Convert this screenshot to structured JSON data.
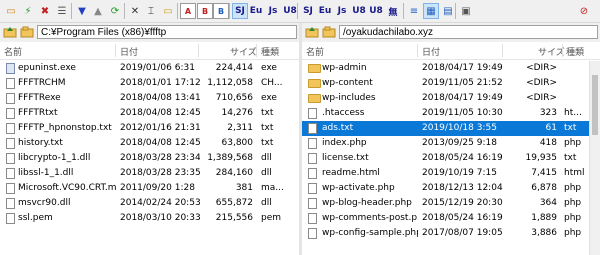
{
  "toolbar": {
    "buttons": [
      {
        "icon": "folder-open-icon"
      },
      {
        "icon": "connect-icon"
      },
      {
        "icon": "disconnect-icon"
      },
      {
        "icon": "menu-icon"
      },
      {
        "icon": "download-icon"
      },
      {
        "icon": "upload-icon"
      },
      {
        "icon": "refresh-icon"
      },
      {
        "icon": "delete-icon"
      },
      {
        "icon": "rename-icon"
      },
      {
        "icon": "new-folder-icon"
      },
      {
        "icon": "mode-a-icon",
        "text": "A"
      },
      {
        "icon": "mode-b-icon",
        "text": "B"
      },
      {
        "icon": "mode-auto-icon",
        "text": "B"
      },
      {
        "icon": "sjis-icon",
        "text": "SJ"
      },
      {
        "icon": "euc-icon",
        "text": "Eu"
      },
      {
        "icon": "jis-icon",
        "text": "Js"
      },
      {
        "icon": "utf8-icon",
        "text": "U8"
      },
      {
        "icon": "sjis2-icon",
        "text": "SJ"
      },
      {
        "icon": "euc2-icon",
        "text": "Eu"
      },
      {
        "icon": "jis2-icon",
        "text": "Js"
      },
      {
        "icon": "utf8n-icon",
        "text": "U8"
      },
      {
        "icon": "utf8bom-icon",
        "text": "U8"
      },
      {
        "icon": "no-convert-icon",
        "text": "無"
      },
      {
        "icon": "list-view-icon"
      },
      {
        "icon": "detail-view-icon"
      },
      {
        "icon": "grid-view-icon"
      },
      {
        "icon": "settings-icon"
      },
      {
        "icon": "stop-icon"
      }
    ]
  },
  "left": {
    "path": "C:¥Program Files (x86)¥ffftp",
    "headers": {
      "name": "名前",
      "date": "日付",
      "size": "サイズ",
      "type": "種類"
    },
    "files": [
      {
        "name": "epuninst.exe",
        "date": "2019/01/06  6:31",
        "size": "224,414",
        "type": "exe",
        "kind": "exe"
      },
      {
        "name": "FFFTRCHM",
        "date": "2018/01/01 17:12",
        "size": "1,112,058",
        "type": "CH...",
        "kind": "doc"
      },
      {
        "name": "FFFTRexe",
        "date": "2018/04/08 13:41",
        "size": "710,656",
        "type": "exe",
        "kind": "doc"
      },
      {
        "name": "FFFTRtxt",
        "date": "2018/04/08 12:45",
        "size": "14,276",
        "type": "txt",
        "kind": "doc"
      },
      {
        "name": "FFFTP_hpnonstop.txt",
        "date": "2012/01/16 21:31",
        "size": "2,311",
        "type": "txt",
        "kind": "doc"
      },
      {
        "name": "history.txt",
        "date": "2018/04/08 12:45",
        "size": "63,800",
        "type": "txt",
        "kind": "doc"
      },
      {
        "name": "libcrypto-1_1.dll",
        "date": "2018/03/28 23:34",
        "size": "1,389,568",
        "type": "dll",
        "kind": "doc"
      },
      {
        "name": "libssl-1_1.dll",
        "date": "2018/03/28 23:35",
        "size": "284,160",
        "type": "dll",
        "kind": "doc"
      },
      {
        "name": "Microsoft.VC90.CRT.m...",
        "date": "2011/09/20  1:28",
        "size": "381",
        "type": "ma...",
        "kind": "doc"
      },
      {
        "name": "msvcr90.dll",
        "date": "2014/02/24 20:53",
        "size": "655,872",
        "type": "dll",
        "kind": "doc"
      },
      {
        "name": "ssl.pem",
        "date": "2018/03/10 20:33",
        "size": "215,556",
        "type": "pem",
        "kind": "doc"
      }
    ]
  },
  "right": {
    "path": "/oyakudachilabo.xyz",
    "headers": {
      "name": "名前",
      "date": "日付",
      "size": "サイズ",
      "type": "種類"
    },
    "files": [
      {
        "name": "wp-admin",
        "date": "2018/04/17 19:49",
        "size": "<DIR>",
        "type": "",
        "kind": "folder"
      },
      {
        "name": "wp-content",
        "date": "2019/11/05 21:52",
        "size": "<DIR>",
        "type": "",
        "kind": "folder"
      },
      {
        "name": "wp-includes",
        "date": "2018/04/17 19:49",
        "size": "<DIR>",
        "type": "",
        "kind": "folder"
      },
      {
        "name": ".htaccess",
        "date": "2019/11/05 10:30",
        "size": "323",
        "type": "ht...",
        "kind": "doc"
      },
      {
        "name": "ads.txt",
        "date": "2019/10/18  3:55",
        "size": "61",
        "type": "txt",
        "kind": "doc",
        "selected": true
      },
      {
        "name": "index.php",
        "date": "2013/09/25  9:18",
        "size": "418",
        "type": "php",
        "kind": "doc"
      },
      {
        "name": "license.txt",
        "date": "2018/05/24 16:19",
        "size": "19,935",
        "type": "txt",
        "kind": "doc"
      },
      {
        "name": "readme.html",
        "date": "2019/10/19  7:15",
        "size": "7,415",
        "type": "html",
        "kind": "doc"
      },
      {
        "name": "wp-activate.php",
        "date": "2018/12/13 12:04",
        "size": "6,878",
        "type": "php",
        "kind": "doc"
      },
      {
        "name": "wp-blog-header.php",
        "date": "2015/12/19 20:30",
        "size": "364",
        "type": "php",
        "kind": "doc"
      },
      {
        "name": "wp-comments-post.p...",
        "date": "2018/05/24 16:19",
        "size": "1,889",
        "type": "php",
        "kind": "doc"
      },
      {
        "name": "wp-config-sample.php",
        "date": "2017/08/07 19:05",
        "size": "3,886",
        "type": "php",
        "kind": "doc"
      }
    ]
  }
}
